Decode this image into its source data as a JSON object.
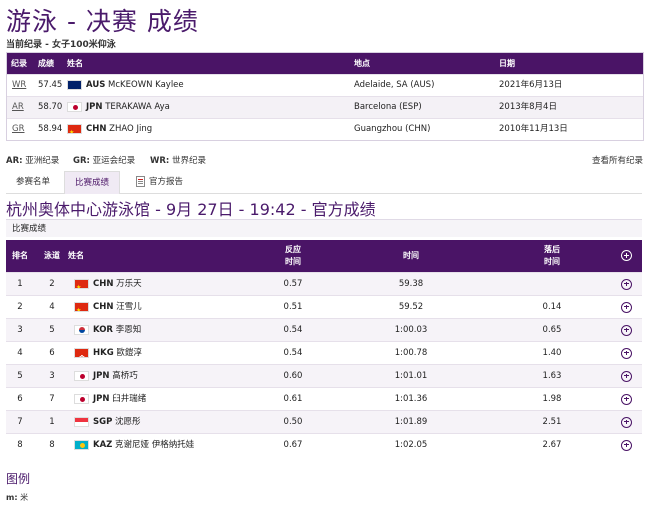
{
  "page": {
    "title": "游泳 - 决赛 成绩",
    "subtitle": "当前纪录 - 女子100米仰泳"
  },
  "records": {
    "headers": {
      "record": "纪录",
      "result": "成绩",
      "name": "姓名",
      "location": "地点",
      "date": "日期"
    },
    "rows": [
      {
        "code": "WR",
        "result": "57.45",
        "country": "AUS",
        "flag": "au",
        "name": "McKEOWN Kaylee",
        "location": "Adelaide, SA (AUS)",
        "date": "2021年6月13日"
      },
      {
        "code": "AR",
        "result": "58.70",
        "country": "JPN",
        "flag": "jp",
        "name": "TERAKAWA Aya",
        "location": "Barcelona (ESP)",
        "date": "2013年8月4日"
      },
      {
        "code": "GR",
        "result": "58.94",
        "country": "CHN",
        "flag": "cn",
        "name": "ZHAO Jing",
        "location": "Guangzhou (CHN)",
        "date": "2010年11月13日"
      }
    ]
  },
  "record_legend": {
    "ar_code": "AR:",
    "ar_text": "亚洲纪录",
    "gr_code": "GR:",
    "gr_text": "亚运会纪录",
    "wr_code": "WR:",
    "wr_text": "世界纪录",
    "view_all": "查看所有纪录"
  },
  "tabs": [
    {
      "label": "参赛名单",
      "active": false
    },
    {
      "label": "比赛成绩",
      "active": true
    },
    {
      "label": "官方报告",
      "active": false,
      "icon": "document-icon"
    }
  ],
  "session": {
    "heading": "杭州奥体中心游泳馆 - 9月 27日 - 19:42 - 官方成绩",
    "section_label": "比赛成绩"
  },
  "results": {
    "headers": {
      "rank": "排名",
      "lane": "泳道",
      "name": "姓名",
      "reaction": "反应时间",
      "time": "时间",
      "behind": "落后时间"
    },
    "rows": [
      {
        "rank": "1",
        "lane": "2",
        "country": "CHN",
        "flag": "cn",
        "name": "万乐天",
        "reaction": "0.57",
        "time": "59.38",
        "behind": ""
      },
      {
        "rank": "2",
        "lane": "4",
        "country": "CHN",
        "flag": "cn",
        "name": "汪雪儿",
        "reaction": "0.51",
        "time": "59.52",
        "behind": "0.14"
      },
      {
        "rank": "3",
        "lane": "5",
        "country": "KOR",
        "flag": "kr",
        "name": "李恩知",
        "reaction": "0.54",
        "time": "1:00.03",
        "behind": "0.65"
      },
      {
        "rank": "4",
        "lane": "6",
        "country": "HKG",
        "flag": "hk",
        "name": "歐鎧淳",
        "reaction": "0.54",
        "time": "1:00.78",
        "behind": "1.40"
      },
      {
        "rank": "5",
        "lane": "3",
        "country": "JPN",
        "flag": "jp",
        "name": "高桥巧",
        "reaction": "0.60",
        "time": "1:01.01",
        "behind": "1.63"
      },
      {
        "rank": "6",
        "lane": "7",
        "country": "JPN",
        "flag": "jp",
        "name": "臼井瑞绪",
        "reaction": "0.61",
        "time": "1:01.36",
        "behind": "1.98"
      },
      {
        "rank": "7",
        "lane": "1",
        "country": "SGP",
        "flag": "sg",
        "name": "沈愿彤",
        "reaction": "0.50",
        "time": "1:01.89",
        "behind": "2.51"
      },
      {
        "rank": "8",
        "lane": "8",
        "country": "KAZ",
        "flag": "kz",
        "name": "克谢尼娅 伊格纳托娃",
        "reaction": "0.67",
        "time": "1:02.05",
        "behind": "2.67"
      }
    ]
  },
  "legend": {
    "title": "图例",
    "m_code": "m:",
    "m_text": "米"
  }
}
